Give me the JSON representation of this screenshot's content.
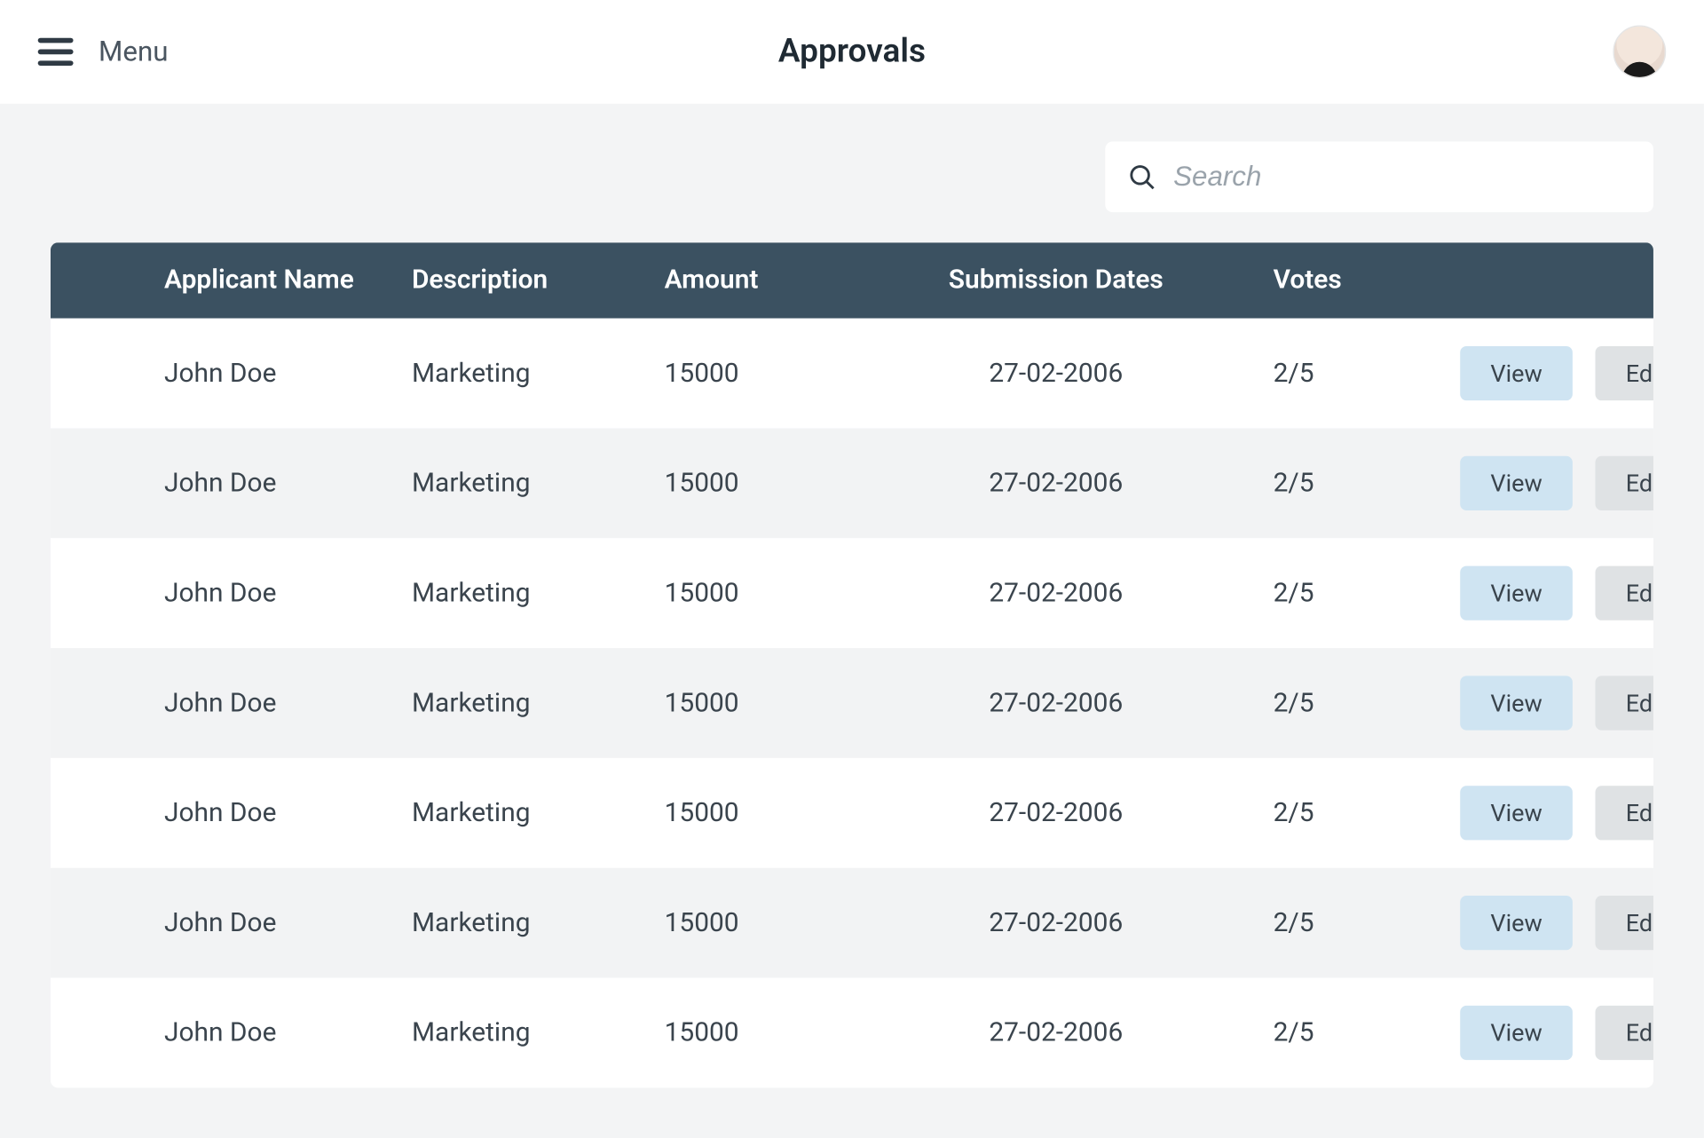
{
  "header": {
    "menu_label": "Menu",
    "page_title": "Approvals"
  },
  "search": {
    "placeholder": "Search",
    "value": ""
  },
  "table": {
    "columns": {
      "applicant": "Applicant Name",
      "description": "Description",
      "amount": "Amount",
      "submission": "Submission Dates",
      "votes": "Votes"
    },
    "actions": {
      "view_label": "View",
      "edit_label": "Edit"
    },
    "rows": [
      {
        "applicant": "John Doe",
        "description": "Marketing",
        "amount": "15000",
        "submission": "27-02-2006",
        "votes": "2/5"
      },
      {
        "applicant": "John Doe",
        "description": "Marketing",
        "amount": "15000",
        "submission": "27-02-2006",
        "votes": "2/5"
      },
      {
        "applicant": "John Doe",
        "description": "Marketing",
        "amount": "15000",
        "submission": "27-02-2006",
        "votes": "2/5"
      },
      {
        "applicant": "John Doe",
        "description": "Marketing",
        "amount": "15000",
        "submission": "27-02-2006",
        "votes": "2/5"
      },
      {
        "applicant": "John Doe",
        "description": "Marketing",
        "amount": "15000",
        "submission": "27-02-2006",
        "votes": "2/5"
      },
      {
        "applicant": "John Doe",
        "description": "Marketing",
        "amount": "15000",
        "submission": "27-02-2006",
        "votes": "2/5"
      },
      {
        "applicant": "John Doe",
        "description": "Marketing",
        "amount": "15000",
        "submission": "27-02-2006",
        "votes": "2/5"
      }
    ]
  }
}
